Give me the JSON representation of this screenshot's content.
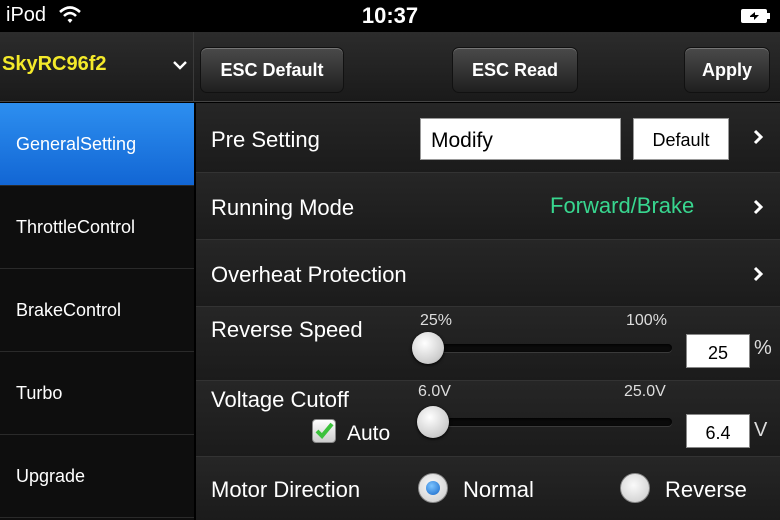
{
  "status_bar": {
    "carrier": "iPod",
    "time": "10:37"
  },
  "header": {
    "device_name": "SkyRC96f2",
    "esc_default_label": "ESC Default",
    "esc_read_label": "ESC Read",
    "apply_label": "Apply"
  },
  "sidebar": {
    "items": [
      {
        "label": "GeneralSetting",
        "active": true
      },
      {
        "label": "ThrottleControl"
      },
      {
        "label": "BrakeControl"
      },
      {
        "label": "Turbo"
      },
      {
        "label": "Upgrade"
      }
    ]
  },
  "settings": {
    "pre_setting": {
      "label": "Pre Setting",
      "value": "Modify",
      "button": "Default"
    },
    "running_mode": {
      "label": "Running Mode",
      "value": "Forward/Brake"
    },
    "overheat": {
      "label": "Overheat Protection"
    },
    "reverse_speed": {
      "label": "Reverse Speed",
      "min_label": "25%",
      "max_label": "100%",
      "value": "25",
      "unit": "%",
      "fraction": 0.0
    },
    "voltage_cutoff": {
      "label": "Voltage Cutoff",
      "min_label": "6.0V",
      "max_label": "25.0V",
      "value": "6.4",
      "unit": "V",
      "fraction": 0.02,
      "auto_label": "Auto",
      "auto_checked": true
    },
    "motor_direction": {
      "label": "Motor Direction",
      "options": [
        "Normal",
        "Reverse"
      ],
      "selected": "Normal"
    }
  },
  "colors": {
    "accent": "#1a7ae0",
    "device_name": "#f4ea2a",
    "mode_value": "#38d68f"
  }
}
